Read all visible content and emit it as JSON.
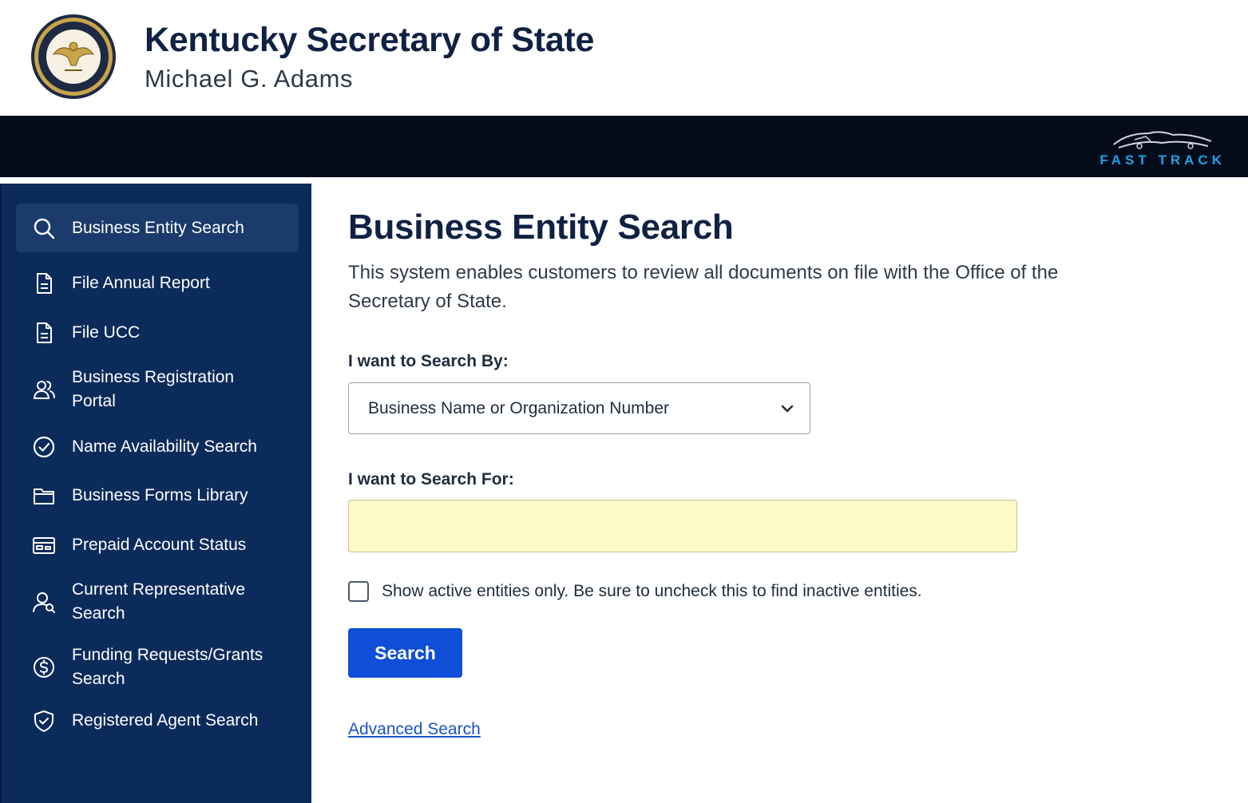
{
  "header": {
    "title": "Kentucky Secretary of State",
    "subtitle": "Michael G. Adams",
    "seal_icon": "commonwealth-seal-icon"
  },
  "topbar": {
    "brand_text": "FAST TRACK",
    "brand_color": "#1aa3e8",
    "background": "#020c1a"
  },
  "sidebar": {
    "background": "#0b2b5b",
    "items": [
      {
        "label": "Business Entity Search",
        "icon": "search-icon",
        "active": true
      },
      {
        "label": "File Annual Report",
        "icon": "document-icon"
      },
      {
        "label": "File UCC",
        "icon": "document-icon"
      },
      {
        "label": "Business Registration Portal",
        "icon": "users-icon"
      },
      {
        "label": "Name Availability Search",
        "icon": "check-circle-icon"
      },
      {
        "label": "Business Forms Library",
        "icon": "folder-icon"
      },
      {
        "label": "Prepaid Account Status",
        "icon": "card-icon"
      },
      {
        "label": "Current Representative Search",
        "icon": "user-search-icon"
      },
      {
        "label": "Funding Requests/Grants Search",
        "icon": "dollar-circle-icon"
      },
      {
        "label": "Registered Agent Search",
        "icon": "shield-check-icon"
      }
    ]
  },
  "main": {
    "title": "Business Entity Search",
    "description": "This system enables customers to review all documents on file with the Office of the Secretary of State.",
    "search_by_label": "I want to Search By:",
    "search_by_value": "Business Name or Organization Number",
    "search_for_label": "I want to Search For:",
    "search_for_value": "",
    "active_only_label": "Show active entities only. Be sure to uncheck this to find inactive entities.",
    "active_only_checked": false,
    "search_button": "Search",
    "advanced_link": "Advanced Search",
    "button_color": "#0f4ed6",
    "input_highlight": "#fdf9c9"
  }
}
